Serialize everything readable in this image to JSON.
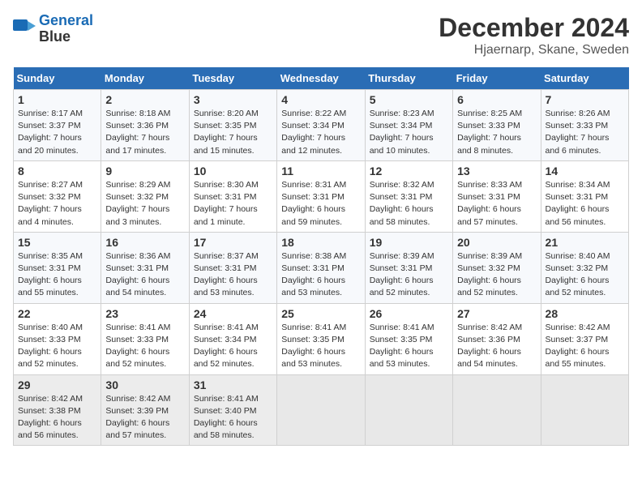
{
  "logo": {
    "line1": "General",
    "line2": "Blue"
  },
  "title": "December 2024",
  "subtitle": "Hjaernarp, Skane, Sweden",
  "days_of_week": [
    "Sunday",
    "Monday",
    "Tuesday",
    "Wednesday",
    "Thursday",
    "Friday",
    "Saturday"
  ],
  "weeks": [
    [
      {
        "day": 1,
        "info": "Sunrise: 8:17 AM\nSunset: 3:37 PM\nDaylight: 7 hours\nand 20 minutes."
      },
      {
        "day": 2,
        "info": "Sunrise: 8:18 AM\nSunset: 3:36 PM\nDaylight: 7 hours\nand 17 minutes."
      },
      {
        "day": 3,
        "info": "Sunrise: 8:20 AM\nSunset: 3:35 PM\nDaylight: 7 hours\nand 15 minutes."
      },
      {
        "day": 4,
        "info": "Sunrise: 8:22 AM\nSunset: 3:34 PM\nDaylight: 7 hours\nand 12 minutes."
      },
      {
        "day": 5,
        "info": "Sunrise: 8:23 AM\nSunset: 3:34 PM\nDaylight: 7 hours\nand 10 minutes."
      },
      {
        "day": 6,
        "info": "Sunrise: 8:25 AM\nSunset: 3:33 PM\nDaylight: 7 hours\nand 8 minutes."
      },
      {
        "day": 7,
        "info": "Sunrise: 8:26 AM\nSunset: 3:33 PM\nDaylight: 7 hours\nand 6 minutes."
      }
    ],
    [
      {
        "day": 8,
        "info": "Sunrise: 8:27 AM\nSunset: 3:32 PM\nDaylight: 7 hours\nand 4 minutes."
      },
      {
        "day": 9,
        "info": "Sunrise: 8:29 AM\nSunset: 3:32 PM\nDaylight: 7 hours\nand 3 minutes."
      },
      {
        "day": 10,
        "info": "Sunrise: 8:30 AM\nSunset: 3:31 PM\nDaylight: 7 hours\nand 1 minute."
      },
      {
        "day": 11,
        "info": "Sunrise: 8:31 AM\nSunset: 3:31 PM\nDaylight: 6 hours\nand 59 minutes."
      },
      {
        "day": 12,
        "info": "Sunrise: 8:32 AM\nSunset: 3:31 PM\nDaylight: 6 hours\nand 58 minutes."
      },
      {
        "day": 13,
        "info": "Sunrise: 8:33 AM\nSunset: 3:31 PM\nDaylight: 6 hours\nand 57 minutes."
      },
      {
        "day": 14,
        "info": "Sunrise: 8:34 AM\nSunset: 3:31 PM\nDaylight: 6 hours\nand 56 minutes."
      }
    ],
    [
      {
        "day": 15,
        "info": "Sunrise: 8:35 AM\nSunset: 3:31 PM\nDaylight: 6 hours\nand 55 minutes."
      },
      {
        "day": 16,
        "info": "Sunrise: 8:36 AM\nSunset: 3:31 PM\nDaylight: 6 hours\nand 54 minutes."
      },
      {
        "day": 17,
        "info": "Sunrise: 8:37 AM\nSunset: 3:31 PM\nDaylight: 6 hours\nand 53 minutes."
      },
      {
        "day": 18,
        "info": "Sunrise: 8:38 AM\nSunset: 3:31 PM\nDaylight: 6 hours\nand 53 minutes."
      },
      {
        "day": 19,
        "info": "Sunrise: 8:39 AM\nSunset: 3:31 PM\nDaylight: 6 hours\nand 52 minutes."
      },
      {
        "day": 20,
        "info": "Sunrise: 8:39 AM\nSunset: 3:32 PM\nDaylight: 6 hours\nand 52 minutes."
      },
      {
        "day": 21,
        "info": "Sunrise: 8:40 AM\nSunset: 3:32 PM\nDaylight: 6 hours\nand 52 minutes."
      }
    ],
    [
      {
        "day": 22,
        "info": "Sunrise: 8:40 AM\nSunset: 3:33 PM\nDaylight: 6 hours\nand 52 minutes."
      },
      {
        "day": 23,
        "info": "Sunrise: 8:41 AM\nSunset: 3:33 PM\nDaylight: 6 hours\nand 52 minutes."
      },
      {
        "day": 24,
        "info": "Sunrise: 8:41 AM\nSunset: 3:34 PM\nDaylight: 6 hours\nand 52 minutes."
      },
      {
        "day": 25,
        "info": "Sunrise: 8:41 AM\nSunset: 3:35 PM\nDaylight: 6 hours\nand 53 minutes."
      },
      {
        "day": 26,
        "info": "Sunrise: 8:41 AM\nSunset: 3:35 PM\nDaylight: 6 hours\nand 53 minutes."
      },
      {
        "day": 27,
        "info": "Sunrise: 8:42 AM\nSunset: 3:36 PM\nDaylight: 6 hours\nand 54 minutes."
      },
      {
        "day": 28,
        "info": "Sunrise: 8:42 AM\nSunset: 3:37 PM\nDaylight: 6 hours\nand 55 minutes."
      }
    ],
    [
      {
        "day": 29,
        "info": "Sunrise: 8:42 AM\nSunset: 3:38 PM\nDaylight: 6 hours\nand 56 minutes."
      },
      {
        "day": 30,
        "info": "Sunrise: 8:42 AM\nSunset: 3:39 PM\nDaylight: 6 hours\nand 57 minutes."
      },
      {
        "day": 31,
        "info": "Sunrise: 8:41 AM\nSunset: 3:40 PM\nDaylight: 6 hours\nand 58 minutes."
      },
      null,
      null,
      null,
      null
    ]
  ]
}
